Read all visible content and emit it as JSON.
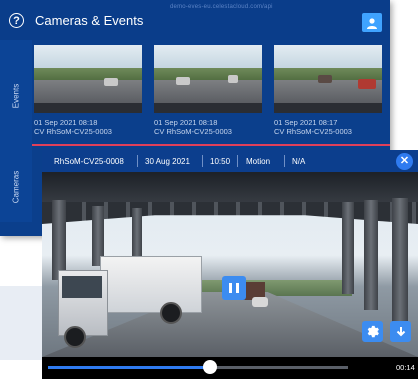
{
  "header": {
    "title": "Cameras & Events",
    "url": "demo-eves-eu.celestacloud.com/api"
  },
  "side_tabs": {
    "events": "Events",
    "cameras": "Cameras"
  },
  "thumbnails": [
    {
      "date": "01 Sep 2021 08:18",
      "camera": "CV  RhSoM-CV25-0003"
    },
    {
      "date": "01 Sep 2021 08:18",
      "camera": "CV  RhSoM-CV25-0003"
    },
    {
      "date": "01 Sep 2021 08:17",
      "camera": "CV  RhSoM-CV25-0003"
    }
  ],
  "player": {
    "device": "RhSoM-CV25-0008",
    "date": "30 Aug 2021",
    "time": "10:50",
    "event_type": "Motion",
    "extra": "N/A",
    "current_time": "00:14",
    "progress": 0.54
  },
  "colors": {
    "primary": "#0c3e8d",
    "accent": "#3c8cf0",
    "divider": "#e0405a"
  },
  "icons": {
    "help": "help-icon",
    "user": "user-icon",
    "close": "close-icon",
    "pause": "pause-icon",
    "settings": "gear-icon",
    "download": "download-icon"
  }
}
